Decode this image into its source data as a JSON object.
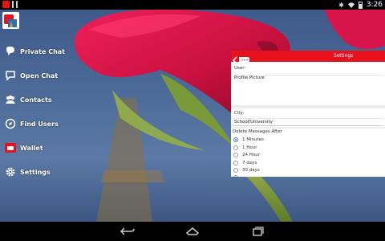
{
  "status_bar": {
    "time": "3:26"
  },
  "side_menu": {
    "items": [
      {
        "label": "Private Chat",
        "icon": "chat-bubble-icon"
      },
      {
        "label": "Open Chat",
        "icon": "open-chat-icon"
      },
      {
        "label": "Contacts",
        "icon": "contacts-icon"
      },
      {
        "label": "Find Users",
        "icon": "compass-icon"
      },
      {
        "label": "Wallet",
        "icon": "wallet-icon"
      },
      {
        "label": "Settings",
        "icon": "gear-icon"
      }
    ]
  },
  "settings": {
    "title": "Settings",
    "user_label": "User:",
    "profile_picture": "Profile Picture",
    "city_label": "City:",
    "school_placeholder": "School/University",
    "delete_label": "Delete Messages After",
    "delete_options": [
      {
        "label": "1 Minutes",
        "selected": true
      },
      {
        "label": "1 Hour",
        "selected": false
      },
      {
        "label": "24 Hour",
        "selected": false
      },
      {
        "label": "7 days",
        "selected": false
      },
      {
        "label": "30 days",
        "selected": false
      },
      {
        "label": "",
        "selected": false
      }
    ]
  },
  "colors": {
    "accent": "#e8121e",
    "radio_selected": "#3a7bd5"
  }
}
